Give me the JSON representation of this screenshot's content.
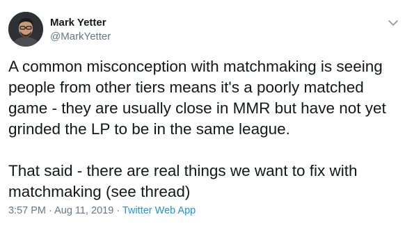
{
  "author": {
    "name": "Mark Yetter",
    "handle": "@MarkYetter",
    "avatar_icon": "user-avatar"
  },
  "menu": {
    "icon": "chevron-down-icon"
  },
  "tweet": {
    "paragraph1_lines": [
      "A common misconception with matchmaking is seeing",
      "people from other tiers means it's a poorly matched",
      "game - they are usually close in MMR but have not yet",
      "grinded the LP to be in the same league."
    ],
    "paragraph2_lines": [
      "That said - there are real things we want to fix with",
      "matchmaking (see thread)"
    ]
  },
  "meta": {
    "time": "3:57 PM",
    "separator": " · ",
    "date": "Aug 11, 2019",
    "source": "Twitter Web App"
  },
  "colors": {
    "text": "#14171a",
    "secondary": "#657786",
    "link": "#1b95e0",
    "background": "#ffffff"
  }
}
